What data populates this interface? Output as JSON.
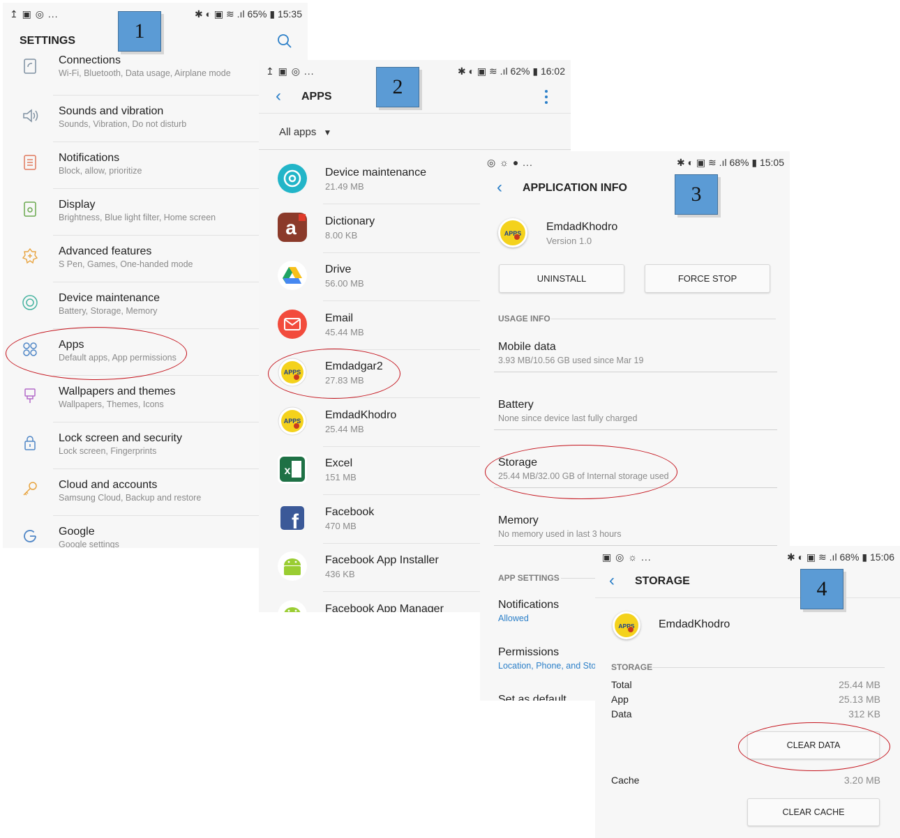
{
  "panel1": {
    "status_left": "↥ ▣ ◎ ...",
    "status_right": "✱ ◐ ▣ ≋ .ıl 65% ▮ 15:35",
    "title": "SETTINGS",
    "badge": "1",
    "items": [
      {
        "title": "Connections",
        "subtitle": "Wi-Fi, Bluetooth, Data usage, Airplane mode",
        "icon": "connections-icon"
      },
      {
        "title": "Sounds and vibration",
        "subtitle": "Sounds, Vibration, Do not disturb",
        "icon": "sound-icon"
      },
      {
        "title": "Notifications",
        "subtitle": "Block, allow, prioritize",
        "icon": "notifications-icon"
      },
      {
        "title": "Display",
        "subtitle": "Brightness, Blue light filter, Home screen",
        "icon": "display-icon"
      },
      {
        "title": "Advanced features",
        "subtitle": "S Pen, Games, One-handed mode",
        "icon": "advanced-features-icon"
      },
      {
        "title": "Device maintenance",
        "subtitle": "Battery, Storage, Memory",
        "icon": "device-maintenance-icon"
      },
      {
        "title": "Apps",
        "subtitle": "Default apps, App permissions",
        "icon": "apps-icon"
      },
      {
        "title": "Wallpapers and themes",
        "subtitle": "Wallpapers, Themes, Icons",
        "icon": "wallpapers-icon"
      },
      {
        "title": "Lock screen and security",
        "subtitle": "Lock screen, Fingerprints",
        "icon": "lock-icon"
      },
      {
        "title": "Cloud and accounts",
        "subtitle": "Samsung Cloud, Backup and restore",
        "icon": "key-icon"
      },
      {
        "title": "Google",
        "subtitle": "Google settings",
        "icon": "google-icon"
      }
    ]
  },
  "panel2": {
    "status_left": "↥ ▣ ◎ ...",
    "status_right": "✱ ◐ ▣ ≋ .ıl 62% ▮ 16:02",
    "title": "APPS",
    "badge": "2",
    "filter": "All apps",
    "apps": [
      {
        "name": "Device maintenance",
        "size": "21.49 MB",
        "icon": "device-maintenance-app-icon"
      },
      {
        "name": "Dictionary",
        "size": "8.00 KB",
        "icon": "dictionary-app-icon"
      },
      {
        "name": "Drive",
        "size": "56.00 MB",
        "icon": "drive-app-icon"
      },
      {
        "name": "Email",
        "size": "45.44 MB",
        "icon": "email-app-icon"
      },
      {
        "name": "Emdadgar2",
        "size": "27.83 MB",
        "icon": "emdadgar-app-icon"
      },
      {
        "name": "EmdadKhodro",
        "size": "25.44 MB",
        "icon": "emdadkhodro-app-icon"
      },
      {
        "name": "Excel",
        "size": "151 MB",
        "icon": "excel-app-icon"
      },
      {
        "name": "Facebook",
        "size": "470 MB",
        "icon": "facebook-app-icon"
      },
      {
        "name": "Facebook App Installer",
        "size": "436 KB",
        "icon": "android-app-icon"
      },
      {
        "name": "Facebook App Manager",
        "size": "",
        "icon": "android-app-icon"
      }
    ]
  },
  "panel3": {
    "status_left": "◎ ☼ ● ...",
    "status_right": "✱ ◐ ▣ ≋ .ıl 68% ▮ 15:05",
    "title": "APPLICATION INFO",
    "badge": "3",
    "app_name": "EmdadKhodro",
    "app_version": "Version 1.0",
    "uninstall_label": "UNINSTALL",
    "force_stop_label": "FORCE STOP",
    "usage_section": "USAGE INFO",
    "usage": [
      {
        "title": "Mobile data",
        "subtitle": "3.93 MB/10.56 GB used since Mar 19"
      },
      {
        "title": "Battery",
        "subtitle": "None since device last fully charged"
      },
      {
        "title": "Storage",
        "subtitle": "25.44 MB/32.00 GB of Internal storage used"
      },
      {
        "title": "Memory",
        "subtitle": "No memory used in last 3 hours"
      }
    ],
    "settings_section": "APP SETTINGS",
    "settings": [
      {
        "title": "Notifications",
        "subtitle": "Allowed"
      },
      {
        "title": "Permissions",
        "subtitle": "Location, Phone, and Sto"
      },
      {
        "title": "Set as default",
        "subtitle": ""
      }
    ]
  },
  "panel4": {
    "status_left": "▣ ◎ ☼ ...",
    "status_right": "✱ ◐ ▣ ≋ .ıl 68% ▮ 15:06",
    "title": "STORAGE",
    "badge": "4",
    "app_name": "EmdadKhodro",
    "section": "STORAGE",
    "rows": [
      {
        "label": "Total",
        "value": "25.44 MB"
      },
      {
        "label": "App",
        "value": "25.13 MB"
      },
      {
        "label": "Data",
        "value": "312 KB"
      }
    ],
    "clear_data_label": "CLEAR DATA",
    "cache_label": "Cache",
    "cache_value": "3.20 MB",
    "clear_cache_label": "CLEAR CACHE"
  },
  "colors": {
    "accent": "#2b7fc8",
    "highlight_oval": "#c4121b",
    "badge": "#5b9bd5",
    "icon_stroke": "#7d8fa0"
  }
}
